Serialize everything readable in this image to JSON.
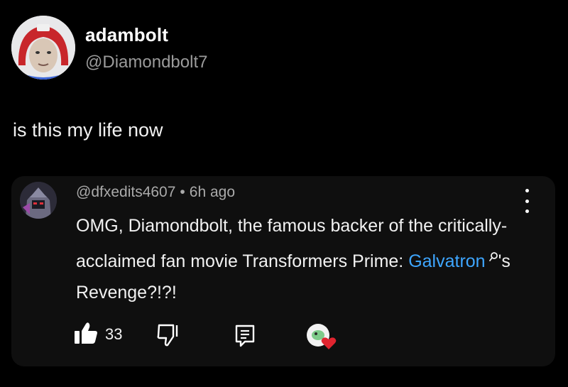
{
  "tweet": {
    "display_name": "adambolt",
    "handle": "@Diamondbolt7",
    "text": "is this my life now"
  },
  "comment": {
    "author": "@dfxedits4607",
    "separator": "•",
    "time": "6h ago",
    "body_before": "OMG, Diamondbolt, the famous backer of the critically-acclaimed fan movie Transformers Prime: ",
    "link_text": "Galvatron",
    "body_after": "'s Revenge?!?!",
    "like_count": "33"
  },
  "icons": {
    "more": "more-vert-icon",
    "like": "thumbs-up-icon",
    "dislike": "thumbs-down-icon",
    "reply": "reply-icon",
    "creator_heart": "creator-heart-icon",
    "search": "search-icon"
  },
  "colors": {
    "background": "#000000",
    "card": "#0f0f0f",
    "link": "#3ea6ff",
    "heart": "#e0242f",
    "muted": "#aaaaaa"
  }
}
